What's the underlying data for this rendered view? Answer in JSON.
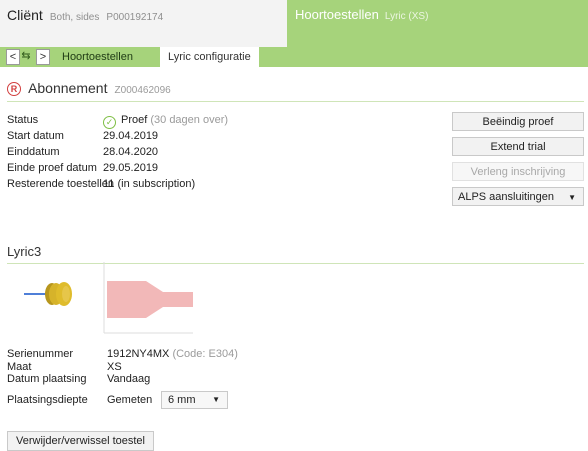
{
  "client": {
    "title": "Cliënt",
    "sides": "Both, sides",
    "id": "P000192174"
  },
  "device_header": {
    "title": "Hoortoestellen",
    "model": "Lyric (XS)"
  },
  "nav": {
    "back": "<",
    "swap": "⇆",
    "forward": ">"
  },
  "tabs": [
    {
      "label": "Hoortoestellen",
      "active": false
    },
    {
      "label": "Lyric configuratie",
      "active": true
    }
  ],
  "subscription": {
    "icon": "registered-icon",
    "title": "Abonnement",
    "id": "Z000462096",
    "rows": [
      {
        "label": "Status",
        "value": "Proef",
        "note": "(30 dagen over)"
      },
      {
        "label": "Start datum",
        "value": "29.04.2019"
      },
      {
        "label": "Einddatum",
        "value": "28.04.2020"
      },
      {
        "label": "Einde proef datum",
        "value": "29.05.2019"
      },
      {
        "label": "Resterende toestellen",
        "value": "11 (in subscription)"
      }
    ]
  },
  "actions": {
    "end_trial": "Beëindig proef",
    "extend_trial": "Extend trial",
    "renew": "Verleng inschrijving",
    "alps": "ALPS aansluitingen"
  },
  "device": {
    "title": "Lyric3",
    "rows": [
      {
        "label": "Serienummer",
        "value": "1912NY4MX",
        "note": "(Code: E304)"
      },
      {
        "label": "Maat",
        "value": "XS"
      },
      {
        "label": "Datum plaatsing",
        "value": "Vandaag"
      }
    ],
    "depth": {
      "label": "Plaatsingsdiepte",
      "value": "Gemeten",
      "selected": "6 mm"
    },
    "replace_button": "Verwijder/verwissel toestel"
  },
  "colors": {
    "accent": "#a6d37b",
    "status_ok": "#7fbf45",
    "registered": "#d23f3f",
    "ear_canal": "#f2b8b8",
    "device": "#d6b32a"
  }
}
